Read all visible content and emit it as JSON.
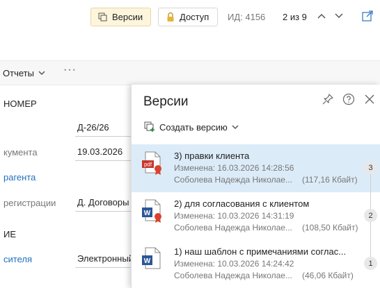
{
  "toolbar": {
    "versions_label": "Версии",
    "access_label": "Доступ",
    "id_text": "ИД: 4156",
    "pager_text": "2 из 9"
  },
  "tabs": {
    "reports_label": "Отчеты",
    "more": "···"
  },
  "form": {
    "section_number": "НОМЕР",
    "label_document": "кумента",
    "label_agent": "рагента",
    "label_registration": "регистрации",
    "section_ie": "ИЕ",
    "label_carrier": "сителя",
    "number_value": "Д-26/26",
    "date_value": "19.03.2026",
    "registration_value": "Д. Договоры",
    "carrier_value": "Электронный"
  },
  "panel": {
    "title": "Версии",
    "create_label": "Создать версию",
    "versions": [
      {
        "number": "3",
        "name": "3) правки клиента",
        "changed": "Изменена: 16.03.2026 14:28:56",
        "author": "Соболева Надежда Николае...",
        "size": "(117,16 Кбайт)",
        "icon": "pdf-icon",
        "badge": true,
        "selected": true
      },
      {
        "number": "2",
        "name": "2) для согласования с клиентом",
        "changed": "Изменена: 10.03.2026 14:31:19",
        "author": "Соболева Надежда Николае...",
        "size": "(108,50 Кбайт)",
        "icon": "word-icon",
        "badge": true,
        "selected": false
      },
      {
        "number": "1",
        "name": "1) наш шаблон с примечаниями соглас...",
        "changed": "Изменена: 10.03.2026 14:24:42",
        "author": "Соболева Надежда Николае...",
        "size": "(46,06 Кбайт)",
        "icon": "word-icon",
        "badge": false,
        "selected": false
      }
    ]
  },
  "colors": {
    "accent_yellow": "#fdf5dc",
    "link_blue": "#1f6fc1",
    "selection": "#dcebf8",
    "pdf_red": "#c8362b",
    "word_blue": "#2b5797",
    "badge_red": "#d9422f"
  }
}
